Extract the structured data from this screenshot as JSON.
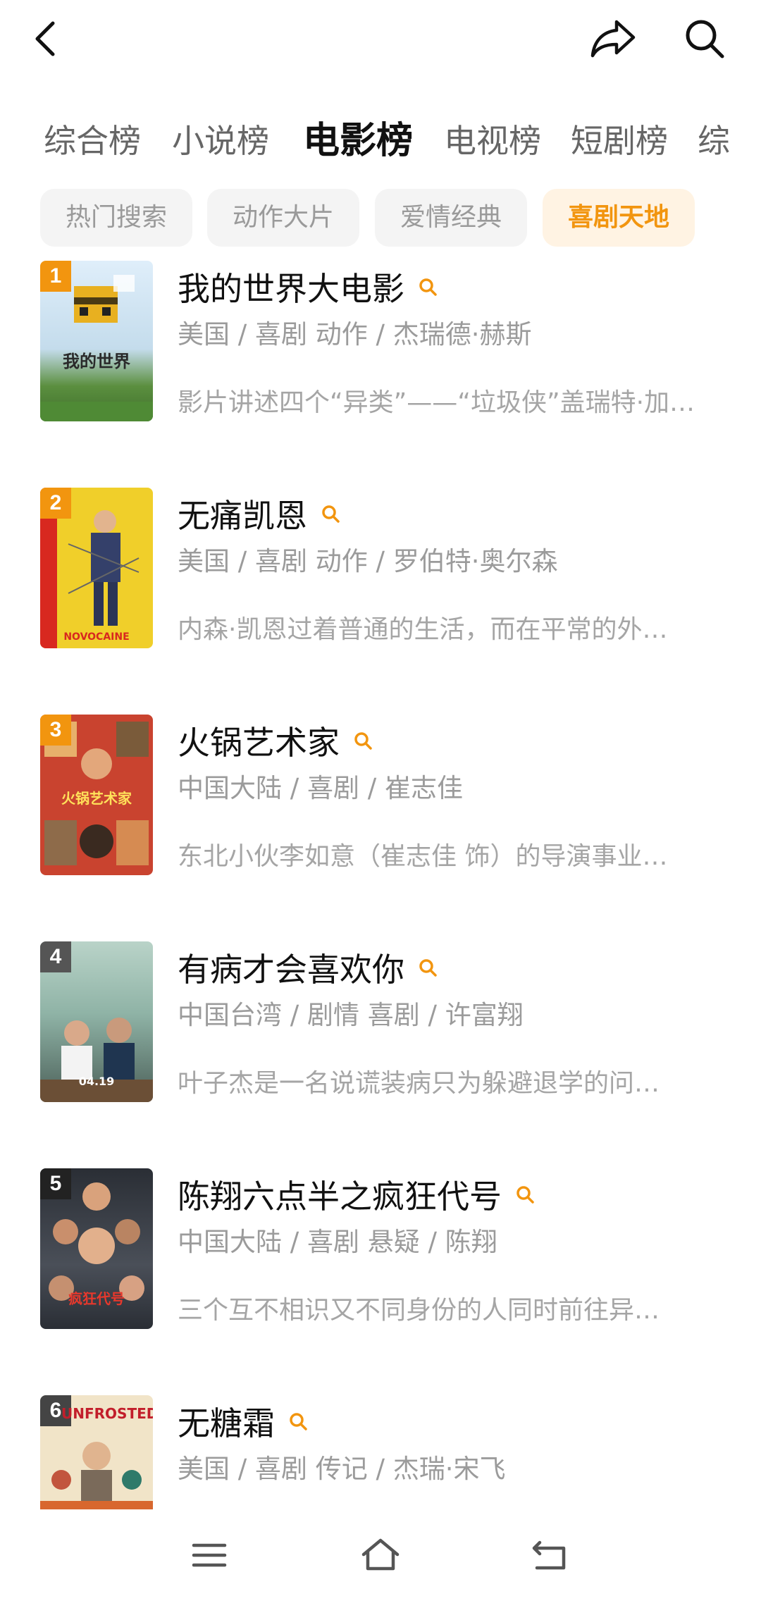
{
  "header": {
    "back_icon": "chevron-left-icon",
    "share_icon": "share-icon",
    "search_icon": "search-icon"
  },
  "tabs": [
    {
      "label": "综合榜",
      "active": false
    },
    {
      "label": "小说榜",
      "active": false
    },
    {
      "label": "电影榜",
      "active": true
    },
    {
      "label": "电视榜",
      "active": false
    },
    {
      "label": "短剧榜",
      "active": false
    },
    {
      "label": "综",
      "active": false
    }
  ],
  "chips": [
    {
      "label": "热门搜索",
      "active": false
    },
    {
      "label": "动作大片",
      "active": false
    },
    {
      "label": "爱情经典",
      "active": false
    },
    {
      "label": "喜剧天地",
      "active": true
    }
  ],
  "accent_color": "#f2950f",
  "movies": [
    {
      "rank": "1",
      "title": "我的世界大电影",
      "meta": "美国 / 喜剧 动作 / 杰瑞德·赫斯",
      "desc": "影片讲述四个“异类”——“垃圾侠”盖瑞特·加…",
      "poster_text": "我的世界",
      "rank_color": "#f2950f",
      "poster_bg": "#d9e8f2"
    },
    {
      "rank": "2",
      "title": "无痛凯恩",
      "meta": "美国 / 喜剧 动作 / 罗伯特·奥尔森",
      "desc": "内森·凯恩过着普通的生活，而在平常的外…",
      "poster_text": "NOVOCAINE",
      "rank_color": "#f2950f",
      "poster_bg": "#f0cf2a"
    },
    {
      "rank": "3",
      "title": "火锅艺术家",
      "meta": "中国大陆 / 喜剧 / 崔志佳",
      "desc": "东北小伙李如意（崔志佳 饰）的导演事业…",
      "poster_text": "火锅艺术家",
      "rank_color": "#f2950f",
      "poster_bg": "#c9432f"
    },
    {
      "rank": "4",
      "title": "有病才会喜欢你",
      "meta": "中国台湾 / 剧情 喜剧 / 许富翔",
      "desc": "叶子杰是一名说谎装病只为躲避退学的问…",
      "poster_text": "04.19",
      "rank_color": "#555555",
      "poster_bg": "#8fb3a6"
    },
    {
      "rank": "5",
      "title": "陈翔六点半之疯狂代号",
      "meta": "中国大陆 / 喜剧 悬疑 / 陈翔",
      "desc": "三个互不相识又不同身份的人同时前往异…",
      "poster_text": "疯狂代号",
      "rank_color": "#222222",
      "poster_bg": "#3a3f48"
    },
    {
      "rank": "6",
      "title": "无糖霜",
      "meta": "美国 / 喜剧 传记 / 杰瑞·宋飞",
      "desc": "",
      "poster_text": "UNFROSTED",
      "rank_color": "#444444",
      "poster_bg": "#f1e4c8"
    }
  ],
  "navbar": {
    "menu_icon": "menu-icon",
    "home_icon": "home-icon",
    "back_icon": "return-icon"
  }
}
